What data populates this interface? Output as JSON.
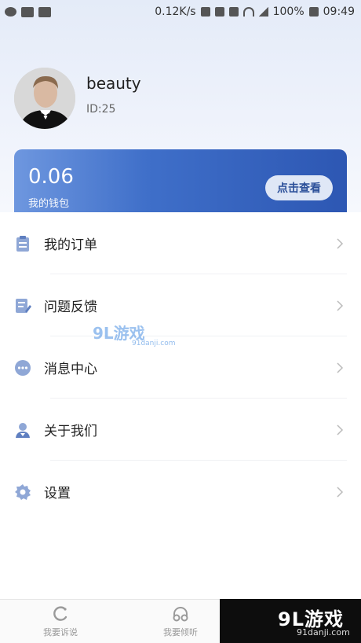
{
  "status_bar": {
    "network_speed": "0.12K/s",
    "battery": "100%",
    "time": "09:49"
  },
  "profile": {
    "username": "beauty",
    "user_id": "ID:25"
  },
  "wallet": {
    "amount": "0.06",
    "label": "我的钱包",
    "view_button": "点击查看"
  },
  "menu": {
    "items": [
      {
        "label": "我的订单",
        "icon": "clipboard-icon"
      },
      {
        "label": "问题反馈",
        "icon": "feedback-edit-icon"
      },
      {
        "label": "消息中心",
        "icon": "chat-bubble-icon"
      },
      {
        "label": "关于我们",
        "icon": "about-people-icon"
      },
      {
        "label": "设置",
        "icon": "gear-icon"
      }
    ]
  },
  "watermark": {
    "logo": "9L游戏",
    "sub": "91danji.com"
  },
  "tab_bar": {
    "tabs": [
      {
        "label": "我要诉说",
        "icon": "speak-icon"
      },
      {
        "label": "我要倾听",
        "icon": "headphones-icon"
      }
    ]
  },
  "brand_overlay": {
    "logo": "9L游戏",
    "site": "91danji.com"
  },
  "colors": {
    "accent": "#3f6fc9",
    "wallet_gradient_start": "#6e97df",
    "wallet_gradient_end": "#2d57b3",
    "icon_blue": "#7f9fd6"
  }
}
